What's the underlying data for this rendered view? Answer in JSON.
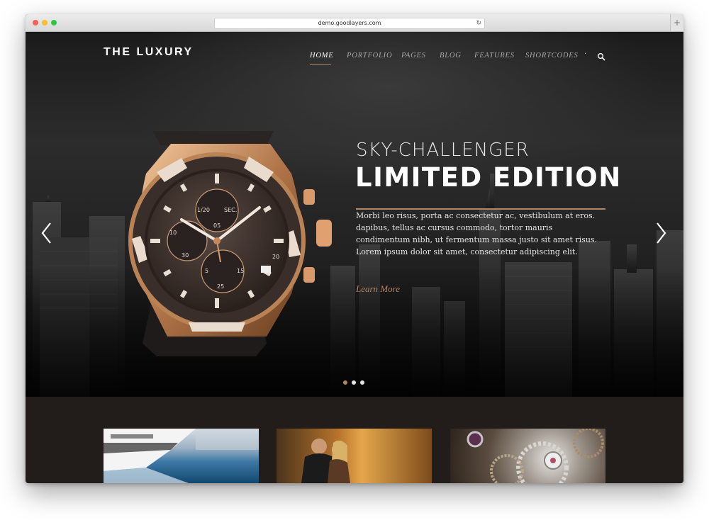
{
  "browser": {
    "url": "demo.goodlayers.com"
  },
  "site": {
    "logo": "THE LUXURY"
  },
  "nav": {
    "items": [
      {
        "label": "HOME",
        "active": true
      },
      {
        "label": "PORTFOLIO",
        "active": false
      },
      {
        "label": "PAGES",
        "active": false
      },
      {
        "label": "BLOG",
        "active": false
      },
      {
        "label": "FEATURES",
        "active": false
      },
      {
        "label": "SHORTCODES",
        "active": false
      }
    ],
    "separator": "·",
    "search_icon": "search-icon"
  },
  "hero": {
    "subtitle": "SKY-CHALLENGER",
    "title": "LIMITED EDITION",
    "body": "Morbi leo risus, porta ac consectetur ac, vestibulum at eros. dapibus, tellus ac cursus commodo, tortor mauris condimentum nibh, ut fermentum massa justo sit amet risus. Lorem ipsum dolor sit amet, consectetur adipiscing elit.",
    "cta": "Learn More",
    "accent_color": "#b08560",
    "slides_total": 3,
    "slide_active": 1,
    "watch_dial": {
      "label_1_20": "1/20",
      "label_sec": "SEC.",
      "sub_05": "05",
      "sub_10": "10",
      "sub_30": "30",
      "sub_15": "15",
      "sub_20": "20",
      "sub_25": "25",
      "sub_5": "5"
    }
  },
  "thumbnails": [
    {
      "subject": "yacht"
    },
    {
      "subject": "couple"
    },
    {
      "subject": "watch-gears"
    }
  ]
}
